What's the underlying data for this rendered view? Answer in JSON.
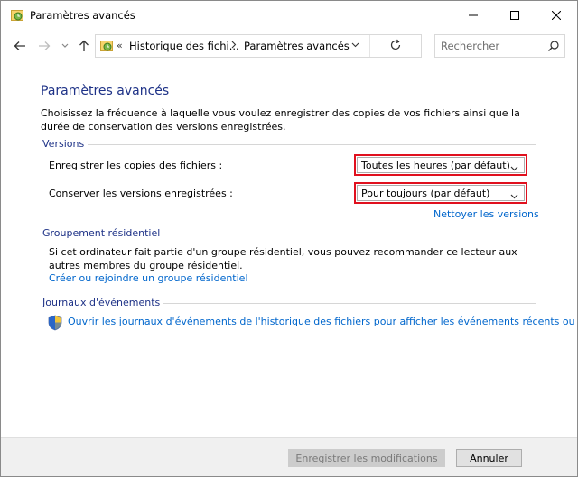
{
  "window": {
    "title": "Paramètres avancés"
  },
  "nav": {
    "breadcrumb_overflow": "«",
    "breadcrumb": [
      "Historique des fichi...",
      "Paramètres avancés"
    ],
    "search_placeholder": "Rechercher"
  },
  "page": {
    "heading": "Paramètres avancés",
    "description": "Choisissez la fréquence à laquelle vous voulez enregistrer des copies de vos fichiers ainsi que la durée de conservation des versions enregistrées."
  },
  "versions": {
    "title": "Versions",
    "save_copies_label": "Enregistrer les copies des fichiers :",
    "save_copies_value": "Toutes les heures (par défaut)",
    "keep_versions_label": "Conserver les versions enregistrées :",
    "keep_versions_value": "Pour toujours (par défaut)",
    "cleanup_link": "Nettoyer les versions"
  },
  "homegroup": {
    "title": "Groupement résidentiel",
    "text": "Si cet ordinateur fait partie d'un groupe résidentiel, vous pouvez recommander ce lecteur aux autres membres du groupe résidentiel.",
    "link": "Créer ou rejoindre un groupe résidentiel"
  },
  "events": {
    "title": "Journaux d'événements",
    "link": "Ouvrir les journaux d'événements de l'historique des fichiers pour afficher les événements récents ou les erreurs récentes"
  },
  "footer": {
    "save_label": "Enregistrer les modifications",
    "cancel_label": "Annuler"
  },
  "colors": {
    "heading": "#1e3287",
    "link": "#0066cc",
    "highlight_border": "#e0101e"
  }
}
